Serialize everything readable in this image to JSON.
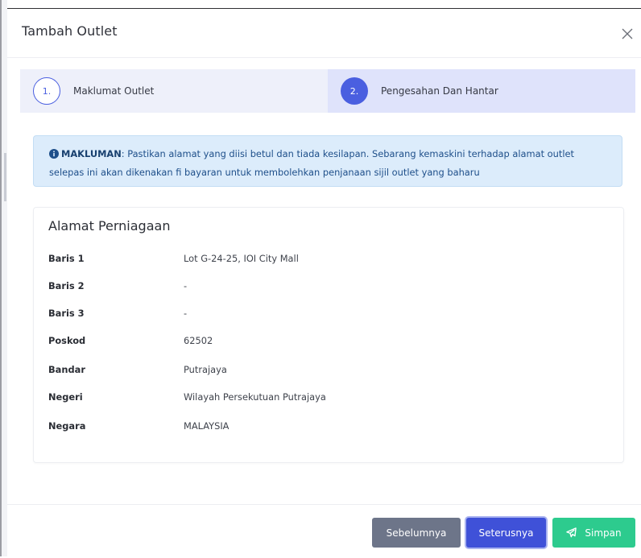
{
  "modal": {
    "title": "Tambah Outlet"
  },
  "stepper": {
    "steps": [
      {
        "number": "1.",
        "label": "Maklumat Outlet",
        "active": false
      },
      {
        "number": "2.",
        "label": "Pengesahan Dan Hantar",
        "active": true
      }
    ]
  },
  "alert": {
    "icon": "info-circle-icon",
    "title": "MAKLUMAN",
    "message": ": Pastikan alamat yang diisi betul dan tiada kesilapan. Sebarang kemaskini terhadap alamat outlet selepas ini akan dikenakan fi bayaran untuk membolehkan penjanaan sijil outlet yang baharu"
  },
  "address": {
    "title": "Alamat Perniagaan",
    "rows": [
      {
        "label": "Baris 1",
        "value": "Lot G-24-25, IOI City Mall"
      },
      {
        "label": "Baris 2",
        "value": "-"
      },
      {
        "label": "Baris 3",
        "value": "-"
      },
      {
        "label": "Poskod",
        "value": "62502"
      },
      {
        "label": "Bandar",
        "value": "Putrajaya"
      },
      {
        "label": "Negeri",
        "value": "Wilayah Persekutuan Putrajaya"
      },
      {
        "label": "Negara",
        "value": "MALAYSIA"
      }
    ]
  },
  "footer": {
    "prev_label": "Sebelumnya",
    "next_label": "Seterusnya",
    "save_label": "Simpan",
    "save_icon": "send-icon"
  },
  "colors": {
    "primary": "#4a5fe0",
    "success": "#2dcb8e",
    "secondary": "#6d7589",
    "info_bg": "#dcecfb"
  }
}
